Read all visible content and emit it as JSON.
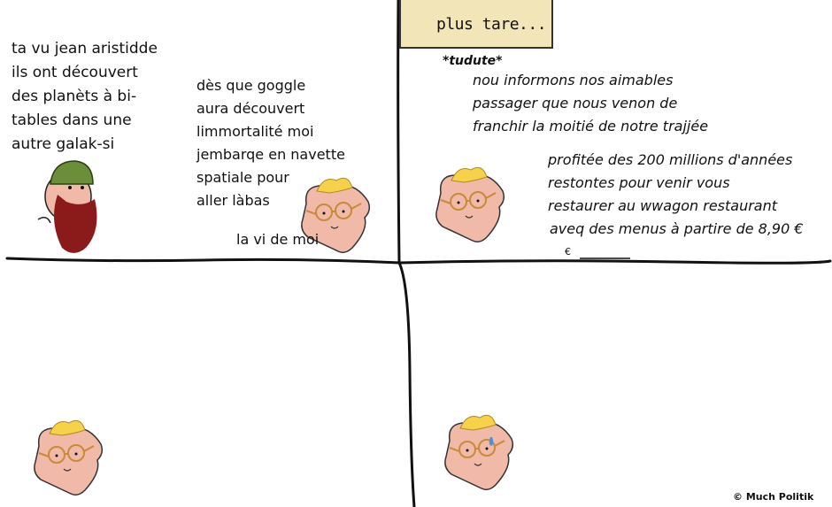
{
  "caption": "plus tare...",
  "sound_effect": "*tudute*",
  "panel1": {
    "speech_lines": [
      "ta vu jean aristidde",
      "ils ont découvert",
      "des planèts à bi-",
      "tables dans une",
      "autre galak-si"
    ]
  },
  "panel2": {
    "speech_lines": [
      "dès que goggle",
      "aura découvert",
      "limmortalité moi",
      "jembarqe en navette",
      "spatiale pour",
      "aller làbas"
    ],
    "aside": "la vi de moi"
  },
  "panel3": {
    "announcement_part1": [
      "nou informons nos aimables",
      "passager que nous venon de",
      "franchir la moitié de notre trajjée"
    ],
    "announcement_part2": [
      "profitée des 200 millions d'années",
      "restontes pour venir vous",
      "restaurer au wwagon restaurant",
      "aveq des menus à partire de 8,90 €"
    ],
    "stray_mark": "€"
  },
  "credit": "© Much Politik",
  "colors": {
    "background": "#ffffff",
    "caption_box": "#f2e6b8",
    "skin": "#f0b9a8",
    "hair": "#f5d24a",
    "glasses": "#c98a3a",
    "beard": "#8b1a1a",
    "cap": "#6b8e3a",
    "ink": "#111111"
  }
}
